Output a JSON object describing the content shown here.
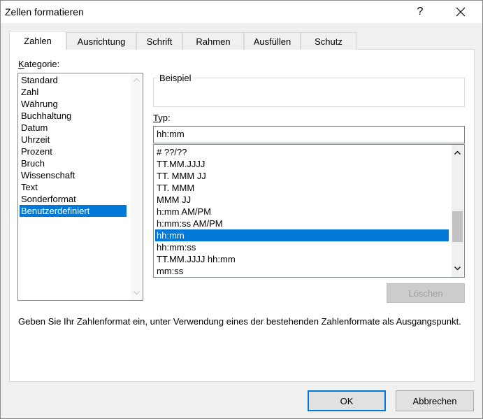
{
  "window": {
    "title": "Zellen formatieren",
    "help_label": "?",
    "close_icon": "close-icon"
  },
  "tabs": [
    {
      "label": "Zahlen",
      "active": true
    },
    {
      "label": "Ausrichtung",
      "active": false
    },
    {
      "label": "Schrift",
      "active": false
    },
    {
      "label": "Rahmen",
      "active": false
    },
    {
      "label": "Ausfüllen",
      "active": false
    },
    {
      "label": "Schutz",
      "active": false
    }
  ],
  "category": {
    "label_first": "K",
    "label_rest": "ategorie:",
    "items": [
      "Standard",
      "Zahl",
      "Währung",
      "Buchhaltung",
      "Datum",
      "Uhrzeit",
      "Prozent",
      "Bruch",
      "Wissenschaft",
      "Text",
      "Sonderformat",
      "Benutzerdefiniert"
    ],
    "selected": "Benutzerdefiniert"
  },
  "sample": {
    "group_title": "Beispiel"
  },
  "type": {
    "label_first": "T",
    "label_rest": "yp:",
    "value": "hh:mm",
    "formats": [
      "# ??/??",
      "TT.MM.JJJJ",
      "TT. MMM JJ",
      "TT. MMM",
      "MMM JJ",
      "h:mm AM/PM",
      "h:mm:ss AM/PM",
      "hh:mm",
      "hh:mm:ss",
      "TT.MM.JJJJ hh:mm",
      "mm:ss"
    ],
    "selected": "hh:mm"
  },
  "delete_button": {
    "label": "Löschen",
    "enabled": false
  },
  "hint": "Geben Sie Ihr Zahlenformat ein, unter Verwendung eines der bestehenden Zahlenformate als Ausgangspunkt.",
  "footer": {
    "ok_label": "OK",
    "cancel_label": "Abbrechen"
  },
  "colors": {
    "selection": "#0078d7",
    "dialog_bg": "#f0f0f0"
  }
}
